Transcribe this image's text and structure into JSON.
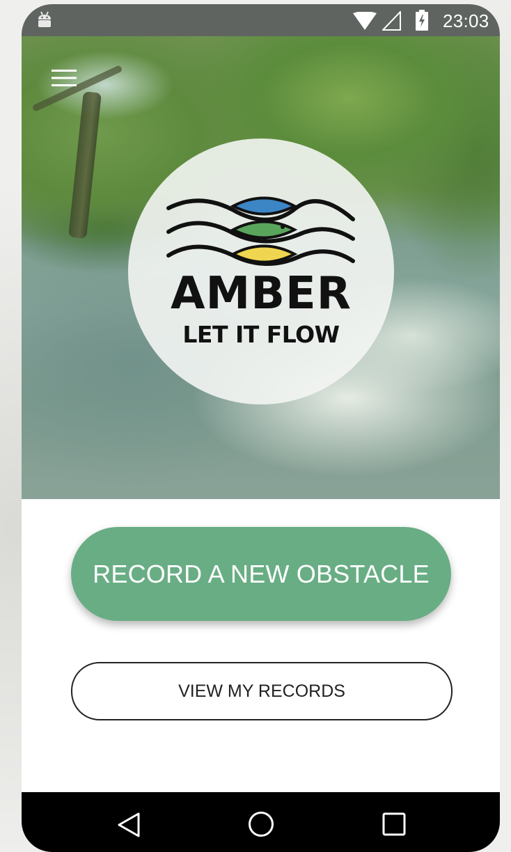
{
  "status_bar": {
    "time": "23:03",
    "icons": [
      "android-icon",
      "wifi-icon",
      "signal-icon",
      "battery-charging-icon"
    ]
  },
  "header": {
    "menu_icon": "hamburger-menu-icon"
  },
  "logo": {
    "title": "AMBER",
    "tagline": "LET IT FLOW",
    "fish_colors": [
      "#3d86c6",
      "#5aa55c",
      "#f0d650"
    ]
  },
  "actions": {
    "record_label": "RECORD A NEW OBSTACLE",
    "view_label": "VIEW MY RECORDS"
  },
  "nav_bar": {
    "icons": [
      "back-icon",
      "home-icon",
      "recents-icon"
    ]
  },
  "colors": {
    "accent": "#69ad84",
    "status_bar": "#5f6461",
    "nav_bar": "#000000"
  }
}
